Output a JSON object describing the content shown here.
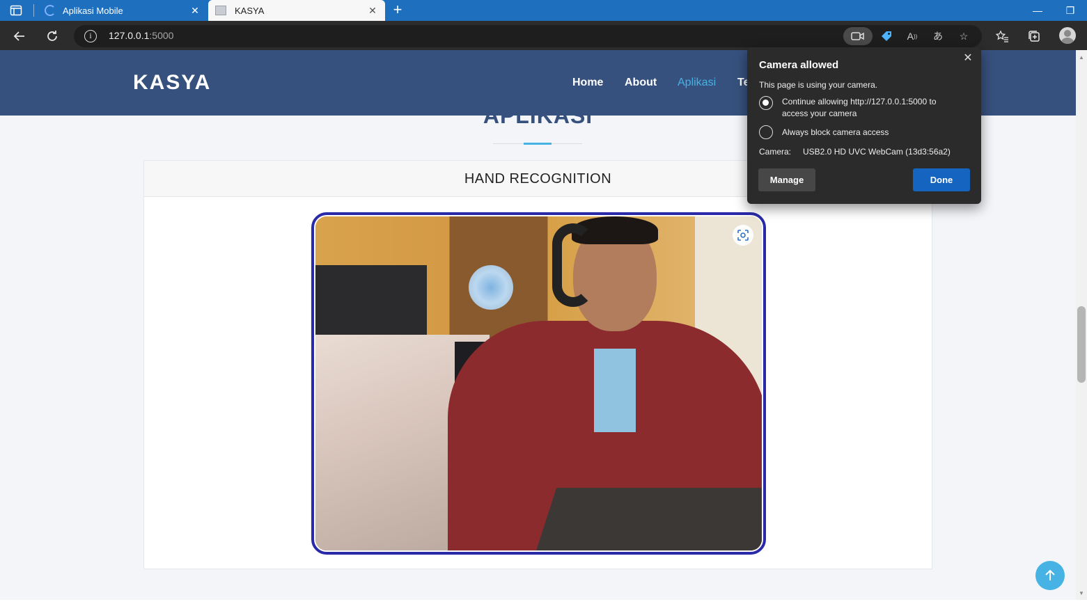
{
  "browser": {
    "tabs": [
      {
        "title": "Aplikasi Mobile",
        "active": false
      },
      {
        "title": "KASYA",
        "active": true
      }
    ],
    "address": {
      "host": "127.0.0.1",
      "port": ":5000"
    },
    "icons": [
      "sidebar-icon",
      "back-icon",
      "refresh-icon",
      "info-icon",
      "camera-icon",
      "tag-icon",
      "read-aloud-icon",
      "translate-icon",
      "favorite-add-icon",
      "favorites-icon",
      "collections-icon",
      "profile-icon",
      "minimize-icon",
      "restore-icon"
    ]
  },
  "site": {
    "logo": "KASYA",
    "nav": [
      {
        "label": "Home",
        "active": false
      },
      {
        "label": "About",
        "active": false
      },
      {
        "label": "Aplikasi",
        "active": true
      },
      {
        "label": "Te",
        "active": false
      }
    ],
    "section_title": "APLIKASI",
    "card_title": "HAND RECOGNITION",
    "accent_color": "#47b2e4",
    "header_color": "#37517e"
  },
  "camera_popup": {
    "title": "Camera allowed",
    "description": "This page is using your camera.",
    "options": [
      {
        "label": "Continue allowing http://127.0.0.1:5000 to access your camera",
        "checked": true
      },
      {
        "label": "Always block camera access",
        "checked": false
      }
    ],
    "camera_label": "Camera:",
    "camera_value": "USB2.0 HD UVC WebCam (13d3:56a2)",
    "manage_label": "Manage",
    "done_label": "Done"
  }
}
